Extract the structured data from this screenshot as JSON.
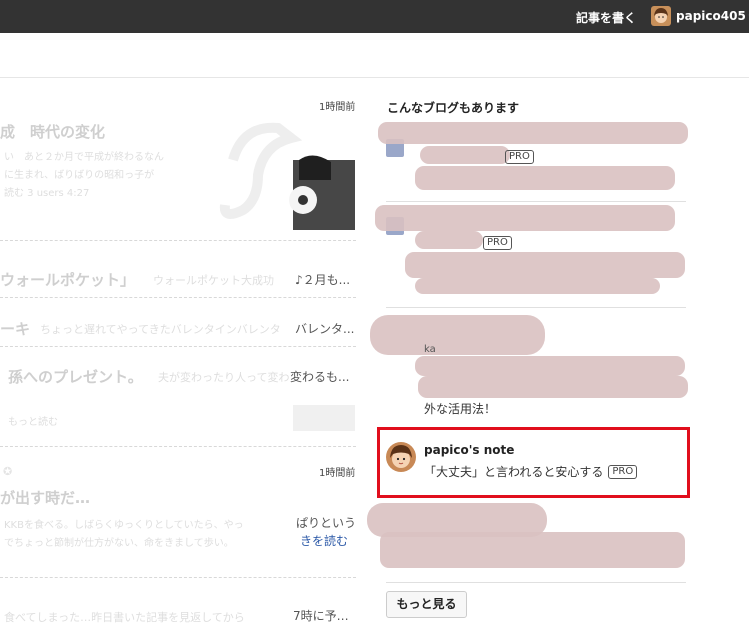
{
  "header": {
    "write_label": "記事を書く",
    "username": "papico405",
    "avatar_icon": "user-avatar-icon"
  },
  "feed": {
    "entries": [
      {
        "time": "1時間前",
        "title_fragment": "成　時代の変化",
        "excerpt_lines": [
          "い　あと２か月で平成が終わるなん",
          "に生まれ、ばりばりの昭和っ子が"
        ],
        "meta": "読む 3 users  4:27"
      },
      {
        "title_fragment": "ウォールポケット」",
        "excerpt": "ウォールポケット大成功",
        "truncated": "♪２月も..."
      },
      {
        "title_fragment": "ーキ",
        "excerpt": "ちょっと遅れてやってきたバレンタインバレンタ",
        "truncated": "バレンタ..."
      },
      {
        "title_fragment": "孫へのプレゼント。",
        "excerpt": "夫が変わったり人って変わ",
        "truncated": "変わるも..."
      },
      {
        "more_label": "もっと読む"
      },
      {
        "time": "1時間前",
        "title_fragment": "が出す時だ…",
        "excerpt_lines": [
          "KKBを食べる。しばらくゆっくりとしていたら、やっ",
          "でちょっと節制が仕方がない、命をきまして歩い。"
        ],
        "trunc_line": "ぱりという",
        "read_more": "きを読む"
      },
      {
        "excerpt": "食べてしまった…昨日書いた記事を見返してから",
        "truncated": "7時に予…"
      }
    ]
  },
  "sidebar": {
    "title": "こんなブログもあります",
    "pro_label": "PRO",
    "blogs": [
      {
        "pro": true
      },
      {
        "pro": true
      },
      {
        "name_prefix": "ka",
        "desc_tail": "外な活用法！"
      },
      {
        "name": "papico's note",
        "desc": "「大丈夫」と言われると安心する",
        "pro": true,
        "highlighted": true
      },
      {}
    ],
    "more_button": "もっと見る"
  }
}
